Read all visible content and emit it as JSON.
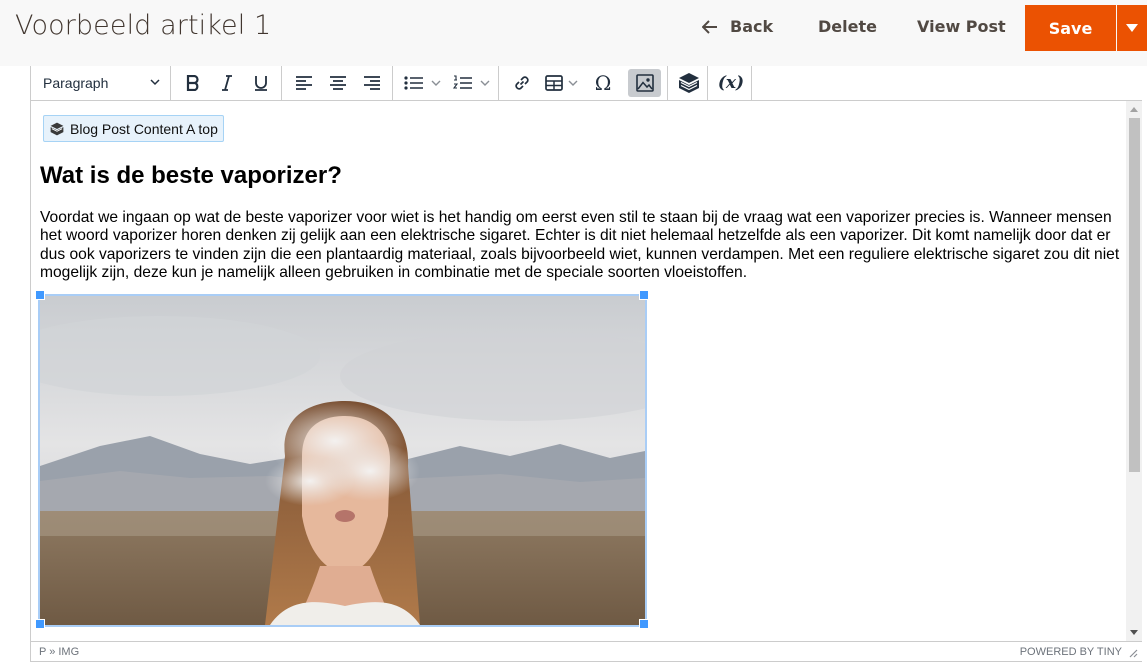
{
  "header": {
    "title": "Voorbeeld artikel 1",
    "back_label": "Back",
    "delete_label": "Delete",
    "view_label": "View Post",
    "save_label": "Save"
  },
  "toolbar": {
    "format_value": "Paragraph",
    "special_char": "Ω",
    "variable_label": "(x)"
  },
  "content": {
    "widget_label": "Blog Post Content A top",
    "heading": "Wat is de beste vaporizer?",
    "paragraph": "Voordat we ingaan op wat de beste vaporizer voor wiet is het handig om eerst even stil te staan bij de vraag wat een vaporizer precies is. Wanneer mensen het woord vaporizer horen denken zij gelijk aan een elektrische sigaret. Echter is dit niet helemaal hetzelfde als een vaporizer. Dit komt namelijk door dat er dus ook vaporizers te vinden zijn die een plantaardig materiaal, zoals bijvoorbeeld wiet, kunnen verdampen. Met een reguliere elektrische sigaret zou dit niet mogelijk zijn, deze kun je namelijk alleen gebruiken in combinatie met de speciale soorten vloeistoffen."
  },
  "statusbar": {
    "path": "P » IMG",
    "powered_by": "POWERED BY TINY"
  },
  "colors": {
    "save": "#eb5202",
    "selection": "#4099ff",
    "active_tool": "#c8cbcf"
  },
  "icons": [
    "arrow-left-icon",
    "bold-icon",
    "italic-icon",
    "underline-icon",
    "align-left-icon",
    "align-center-icon",
    "align-right-icon",
    "bullet-list-icon",
    "numbered-list-icon",
    "link-icon",
    "table-icon",
    "omega-icon",
    "image-icon",
    "widget-icon",
    "variable-icon",
    "resize-icon"
  ]
}
